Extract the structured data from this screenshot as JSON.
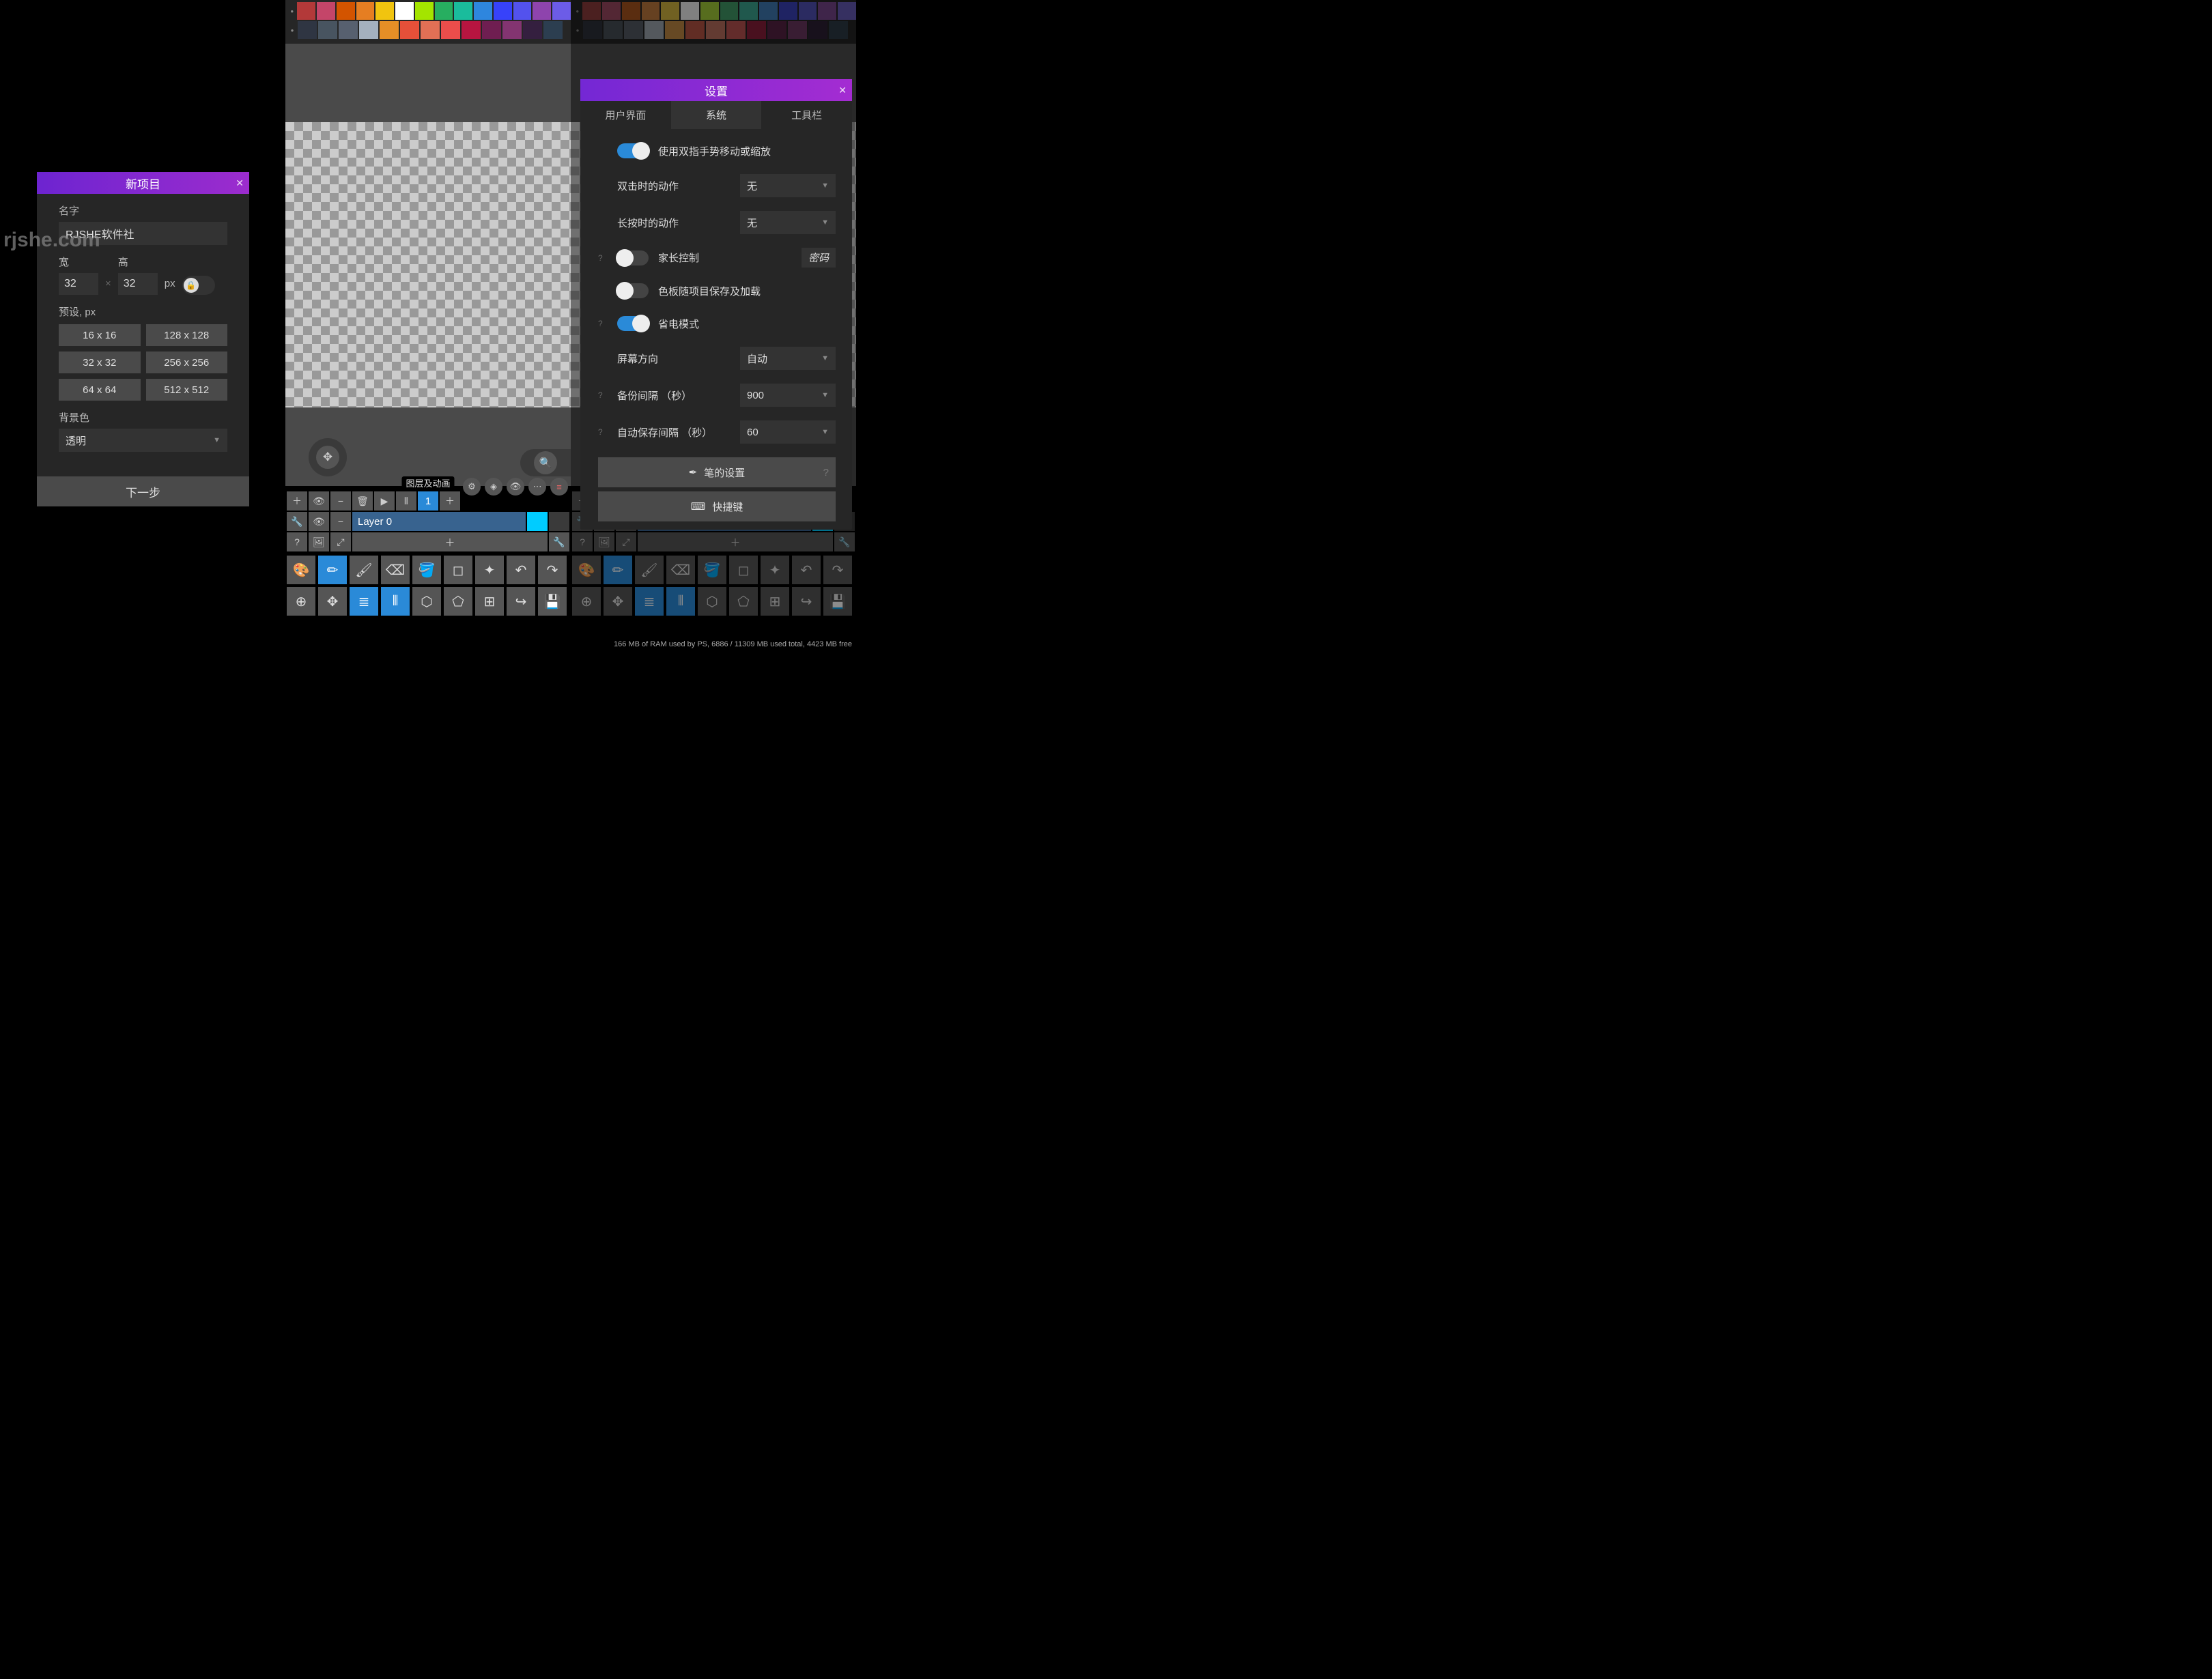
{
  "watermark": "rjshe.com",
  "newProject": {
    "title": "新项目",
    "nameLabel": "名字",
    "nameValue": "RJSHE软件社",
    "widthLabel": "宽",
    "width": "32",
    "heightLabel": "高",
    "height": "32",
    "unit": "px",
    "presetLabel": "预设, px",
    "presets": [
      "16 x 16",
      "128 x 128",
      "32 x 32",
      "256 x 256",
      "64 x 64",
      "512 x 512"
    ],
    "bgLabel": "背景色",
    "bgValue": "透明",
    "next": "下一步"
  },
  "palette": {
    "row1": [
      "#b33939",
      "#c44569",
      "#d35400",
      "#e67e22",
      "#f1c40f",
      "#ffffff",
      "#a4e400",
      "#27ae60",
      "#1abc9c",
      "#2e86de",
      "#3742fa",
      "#5352ed",
      "#8e44ad",
      "#6c5ce7"
    ],
    "row2": [
      "#2f3542",
      "#485460",
      "#57606f",
      "#a4b0be",
      "#e58e26",
      "#e55039",
      "#e17055",
      "#eb4d4b",
      "#b71540",
      "#6F1E51",
      "#833471",
      "#341f3f",
      "#2c3e50"
    ]
  },
  "layers": {
    "tabLabel": "图层及动画",
    "frameNum": "1",
    "layerName": "Layer 0"
  },
  "settings": {
    "title": "设置",
    "tabs": {
      "ui": "用户界面",
      "system": "系统",
      "toolbar": "工具栏"
    },
    "twoFinger": "使用双指手势移动或缩放",
    "doubleTap": {
      "label": "双击时的动作",
      "value": "无"
    },
    "longPress": {
      "label": "长按时的动作",
      "value": "无"
    },
    "parental": {
      "label": "家长控制",
      "password": "密码"
    },
    "paletteSave": "色板随项目保存及加载",
    "powerSave": "省电模式",
    "orientation": {
      "label": "屏幕方向",
      "value": "自动"
    },
    "backup": {
      "label": "备份间隔 （秒）",
      "value": "900"
    },
    "autosave": {
      "label": "自动保存间隔 （秒）",
      "value": "60"
    },
    "penSettings": "笔的设置",
    "shortcuts": "快捷键"
  },
  "status": "166 MB of RAM used by PS, 6886 / 11309 MB used total, 4423 MB free"
}
